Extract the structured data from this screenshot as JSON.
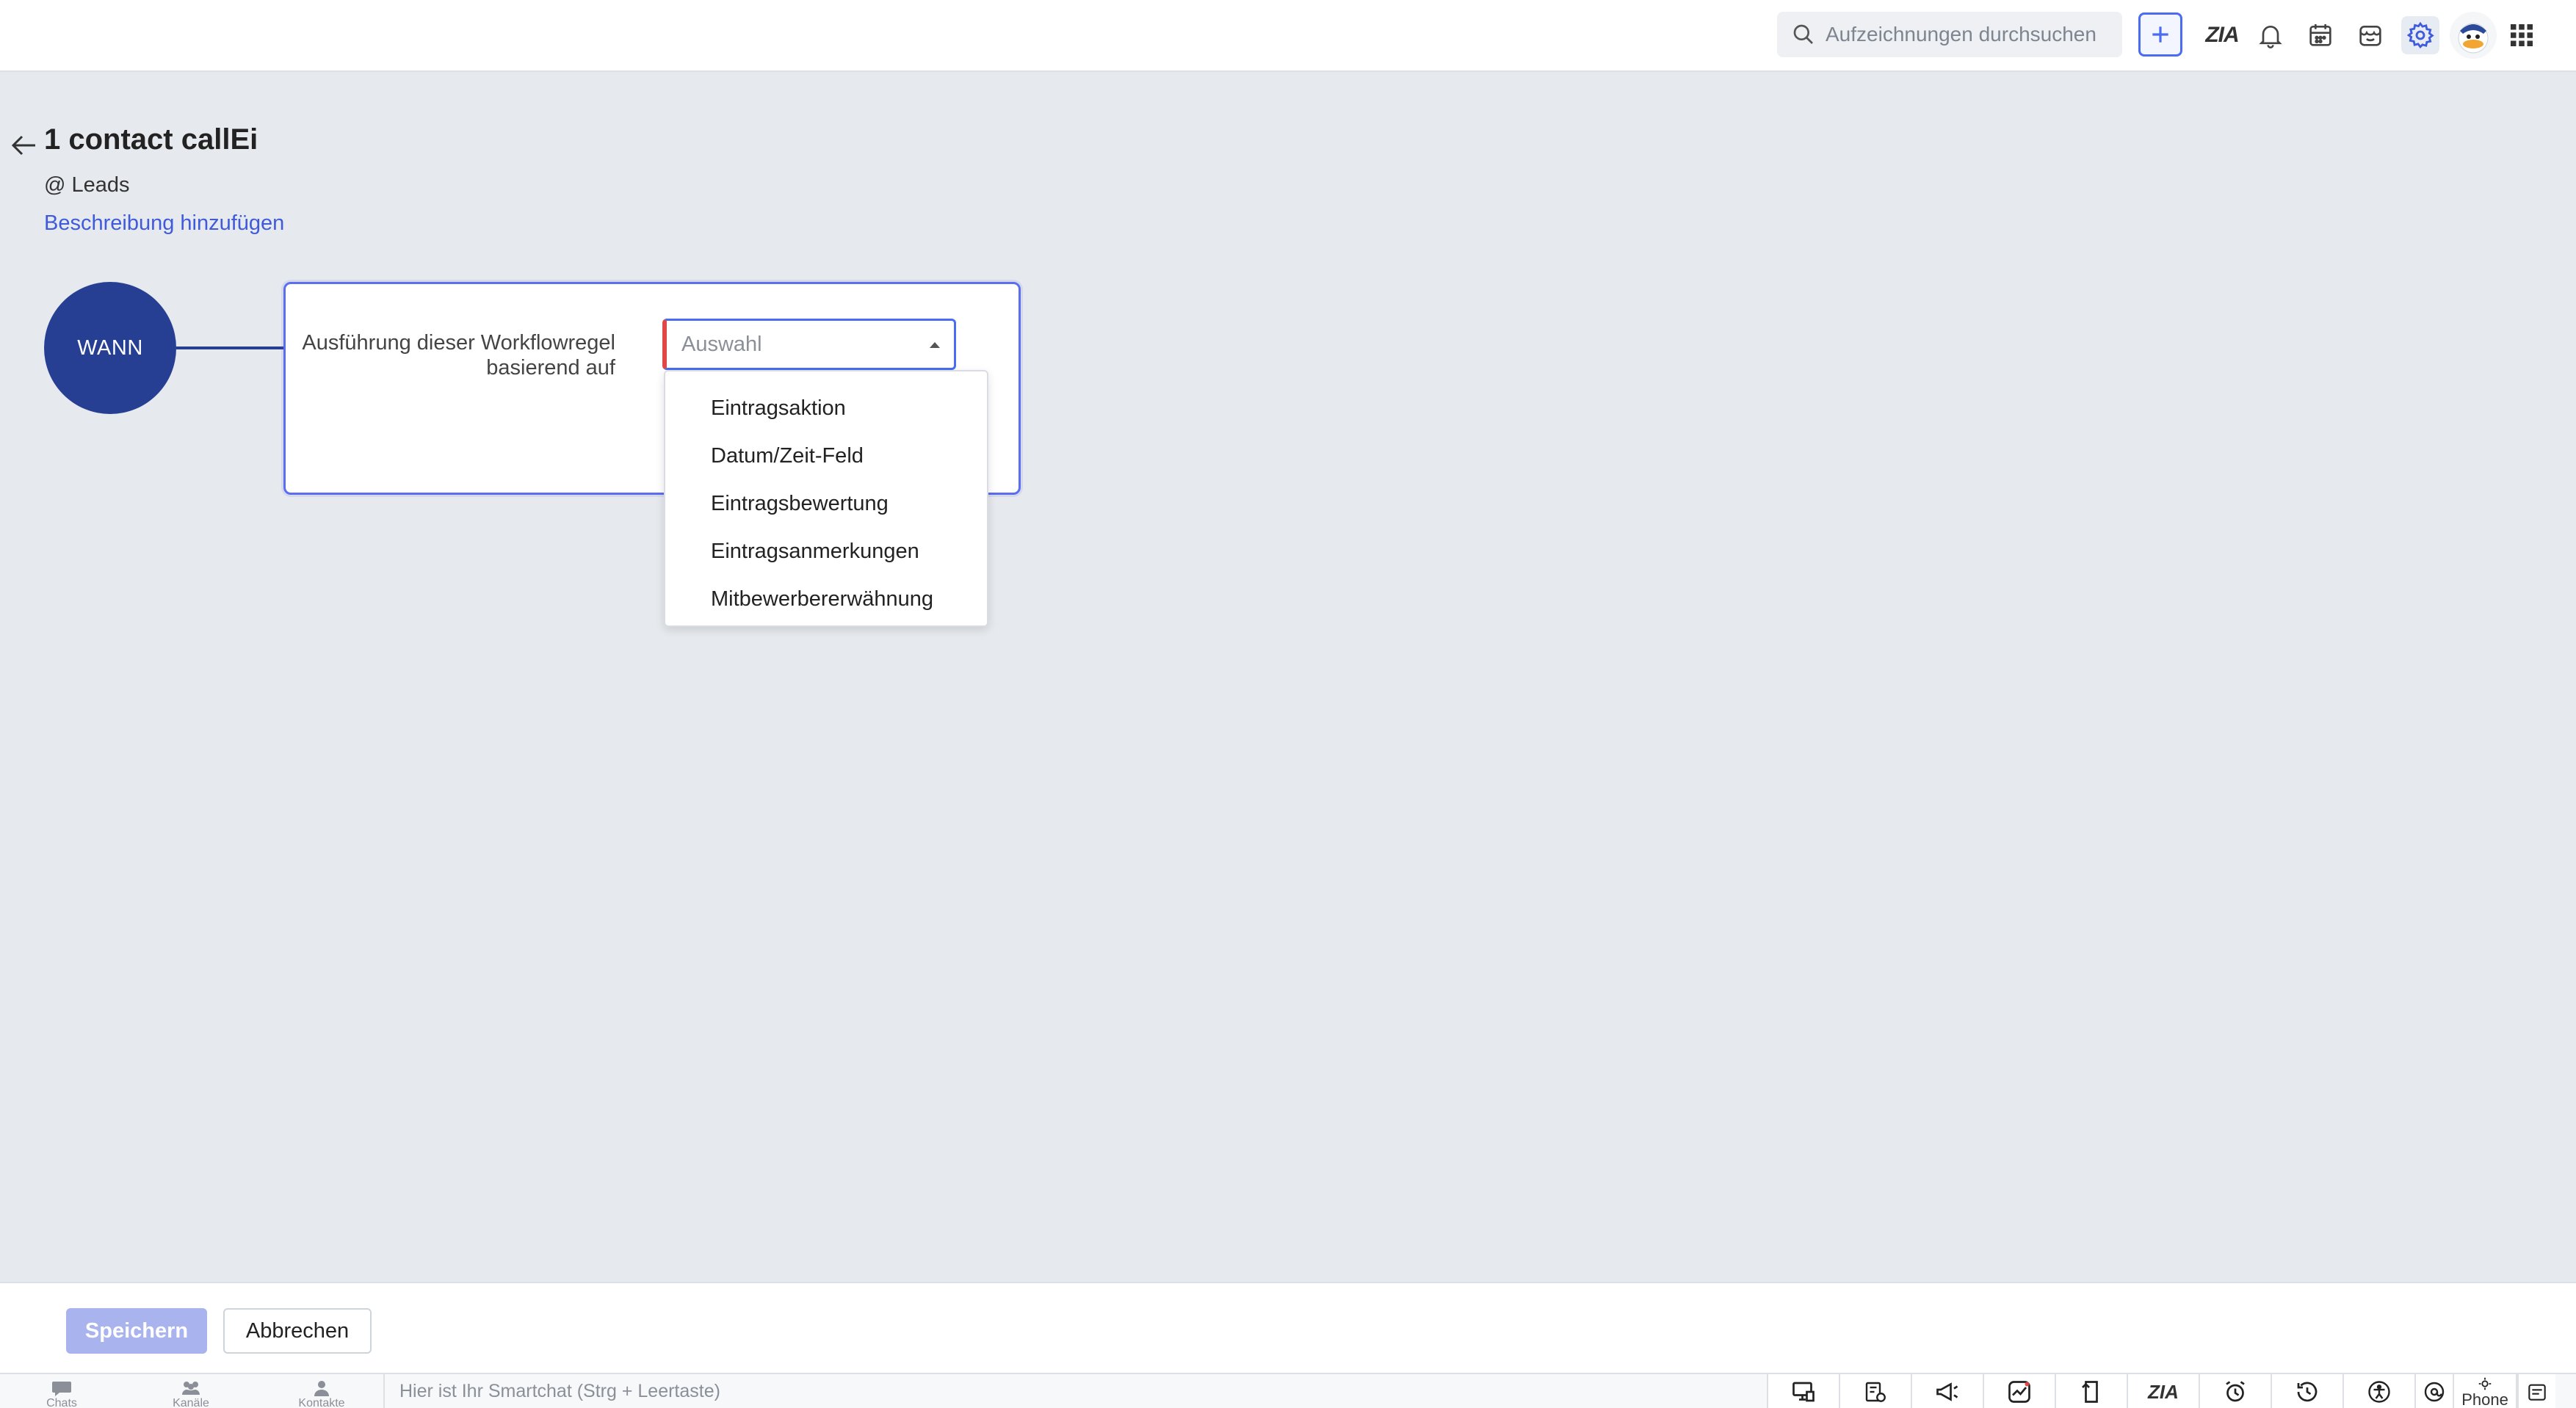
{
  "topbar": {
    "search_placeholder": "Aufzeichnungen durchsuchen",
    "icons": [
      "add-icon",
      "zia-icon",
      "bell-icon",
      "calendar-icon",
      "marketplace-icon",
      "gear-icon",
      "user-avatar",
      "apps-grid-icon"
    ],
    "zia_label": "ZIA"
  },
  "header": {
    "title": "1 contact callEi",
    "module": "@ Leads",
    "add_description": "Beschreibung hinzufügen"
  },
  "workflow": {
    "when_label": "WANN",
    "rule_label": "Ausführung dieser Workflowregel basierend auf",
    "select_placeholder": "Auswahl",
    "options": [
      "Eintragsaktion",
      "Datum/Zeit-Feld",
      "Eintragsbewertung",
      "Eintragsanmerkungen",
      "Mitbewerbererwähnung"
    ]
  },
  "footer": {
    "save_label": "Speichern",
    "cancel_label": "Abbrechen"
  },
  "bottombar": {
    "nav": [
      {
        "label": "Chats",
        "icon": "chat-icon"
      },
      {
        "label": "Kanäle",
        "icon": "channels-icon"
      },
      {
        "label": "Kontakte",
        "icon": "contacts-icon"
      }
    ],
    "smartchat_placeholder": "Hier ist Ihr Smartchat (Strg + Leertaste)",
    "zia_label": "ZIA",
    "phone_label": "Phone"
  },
  "colors": {
    "accent": "#4a6cf0",
    "wann_circle": "#263f93",
    "link": "#3f5bdc",
    "required_marker": "#e04848",
    "save_disabled": "#a9b3ee"
  }
}
